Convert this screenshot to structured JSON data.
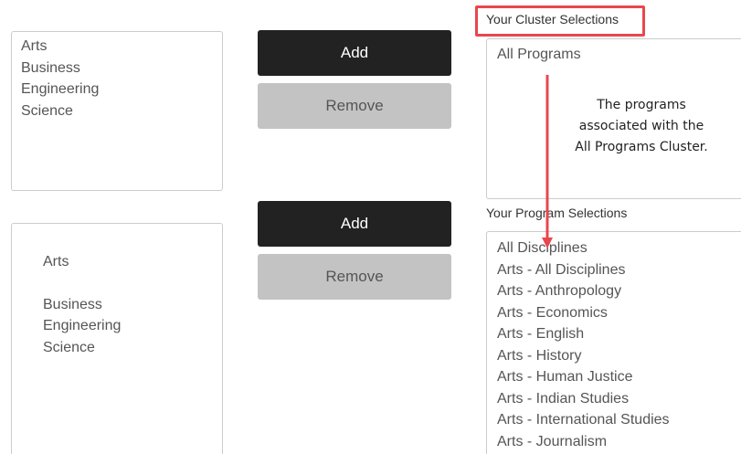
{
  "cluster_source": {
    "items": [
      "Arts",
      "Business",
      "Engineering",
      "Science"
    ]
  },
  "cluster_buttons": {
    "add": "Add",
    "remove": "Remove"
  },
  "cluster_selected": {
    "label": "Your Cluster Selections",
    "items": [
      "All Programs"
    ]
  },
  "annotation": {
    "text": "The programs\nassociated with the\nAll Programs Cluster.",
    "color": "#e8474f"
  },
  "program_source": {
    "items": [
      "Arts",
      "Business",
      "Engineering",
      "Science"
    ]
  },
  "program_buttons": {
    "add": "Add",
    "remove": "Remove"
  },
  "program_selected": {
    "label": "Your Program Selections",
    "items": [
      "All Disciplines",
      "Arts - All Disciplines",
      "Arts - Anthropology",
      "Arts - Economics",
      "Arts - English",
      "Arts - History",
      "Arts - Human Justice",
      "Arts - Indian Studies",
      "Arts - International Studies",
      "Arts - Journalism"
    ]
  }
}
